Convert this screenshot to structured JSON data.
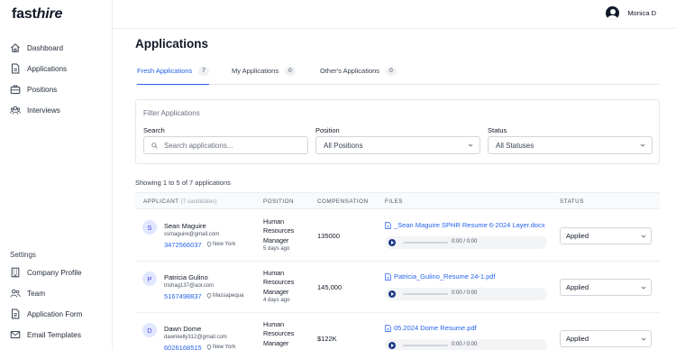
{
  "brand": {
    "bold": "fast",
    "italic": "hire"
  },
  "user": {
    "name": "Monica D"
  },
  "sidebar": {
    "items": [
      {
        "label": "Dashboard",
        "icon": "home-icon"
      },
      {
        "label": "Applications",
        "icon": "document-icon"
      },
      {
        "label": "Positions",
        "icon": "briefcase-icon"
      },
      {
        "label": "Interviews",
        "icon": "users-icon"
      }
    ],
    "settings_label": "Settings",
    "settings_items": [
      {
        "label": "Company Profile",
        "icon": "building-icon"
      },
      {
        "label": "Team",
        "icon": "team-icon"
      },
      {
        "label": "Application Form",
        "icon": "form-icon"
      },
      {
        "label": "Email Templates",
        "icon": "mail-icon"
      }
    ]
  },
  "page": {
    "title": "Applications"
  },
  "tabs": [
    {
      "label": "Fresh Applications",
      "count": "7",
      "active": true
    },
    {
      "label": "My Applications",
      "count": "0",
      "active": false
    },
    {
      "label": "Other's Applications",
      "count": "0",
      "active": false
    }
  ],
  "filters": {
    "title": "Filter Applications",
    "search": {
      "label": "Search",
      "placeholder": "Search applications..."
    },
    "position": {
      "label": "Position",
      "value": "All Positions"
    },
    "status": {
      "label": "Status",
      "value": "All Statuses"
    }
  },
  "summary": "Showing 1 to 5 of 7 applications",
  "table": {
    "headers": {
      "applicant": "APPLICANT",
      "applicant_sub": "(7 candidates)",
      "position": "POSITION",
      "compensation": "COMPENSATION",
      "files": "FILES",
      "status": "STATUS"
    },
    "rows": [
      {
        "initial": "S",
        "name": "Sean Maguire",
        "email": "ssmaguire@gmail.com",
        "phone": "3472566037",
        "location": "New York",
        "position": "Human Resources Manager",
        "ago": "5 days ago",
        "compensation": "135000",
        "file": "_Sean Maguire SPHR Resume 6-2024 Layer.docx",
        "time": "0:00 / 0:00",
        "status": "Applied"
      },
      {
        "initial": "P",
        "name": "Patricia Gulino",
        "email": "trishag137@aol.com",
        "phone": "5167498837",
        "location": "Massapequa",
        "position": "Human Resources Manager",
        "ago": "4 days ago",
        "compensation": "145,000",
        "file": "Patricia_Gulino_Resume 24-1.pdf",
        "time": "0:00 / 0:00",
        "status": "Applied"
      },
      {
        "initial": "D",
        "name": "Dawn Dome",
        "email": "dawnkelly312@gmail.com",
        "phone": "6026168515",
        "location": "New York",
        "position": "Human Resources Manager",
        "ago": "",
        "compensation": "$122K",
        "file": "05.2024 Dome Resume.pdf",
        "time": "0:00 / 0:00",
        "status": "Applied"
      }
    ]
  }
}
